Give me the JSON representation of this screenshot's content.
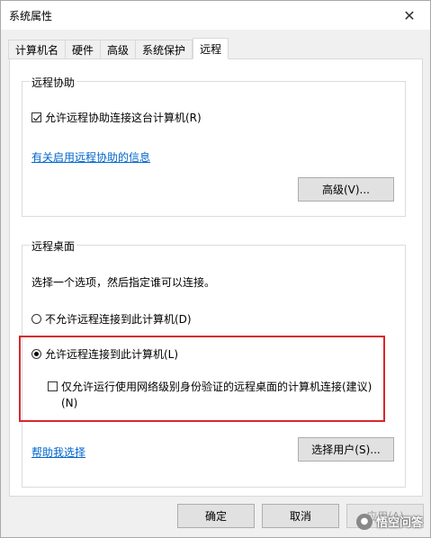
{
  "window": {
    "title": "系统属性"
  },
  "tabs": [
    {
      "label": "计算机名"
    },
    {
      "label": "硬件"
    },
    {
      "label": "高级"
    },
    {
      "label": "系统保护"
    },
    {
      "label": "远程"
    }
  ],
  "remote_assistance": {
    "group_label": "远程协助",
    "allow_label": "允许远程协助连接这台计算机(R)",
    "allow_checked": true,
    "info_link": "有关启用远程协助的信息",
    "advanced_button": "高级(V)..."
  },
  "remote_desktop": {
    "group_label": "远程桌面",
    "instruction": "选择一个选项，然后指定谁可以连接。",
    "option_deny": "不允许远程连接到此计算机(D)",
    "option_allow": "允许远程连接到此计算机(L)",
    "nla_line1": "仅允许运行使用网络级别身份验证的远程桌面的计算机连接(建议)",
    "nla_line2": "(N)",
    "nla_checked": false,
    "help_link": "帮助我选择",
    "select_users_button": "选择用户(S)..."
  },
  "footer": {
    "ok": "确定",
    "cancel": "取消",
    "apply": "应用(A)"
  },
  "watermark": {
    "text": "悟空问答"
  }
}
